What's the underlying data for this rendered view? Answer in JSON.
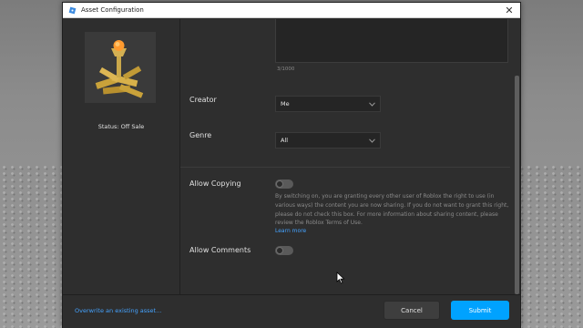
{
  "window": {
    "title": "Asset Configuration",
    "close_glyph": "✕"
  },
  "left": {
    "status": "Status: Off Sale",
    "thumbnail_icon": "torch-model-thumbnail"
  },
  "form": {
    "description_count": "3/1000",
    "creator": {
      "label": "Creator",
      "value": "Me"
    },
    "genre": {
      "label": "Genre",
      "value": "All"
    },
    "allow_copying": {
      "label": "Allow Copying",
      "enabled": false,
      "description": "By switching on, you are granting every other user of Roblox the right to use (in various ways) the content you are now sharing. If you do not want to grant this right, please do not check this box. For more information about sharing content, please review the Roblox Terms of Use.",
      "learn_more": "Learn more"
    },
    "allow_comments": {
      "label": "Allow Comments",
      "enabled": false
    }
  },
  "footer": {
    "overwrite_link": "Overwrite an existing asset...",
    "cancel_label": "Cancel",
    "submit_label": "Submit"
  },
  "colors": {
    "accent": "#00a2ff",
    "link": "#45a3ff",
    "panel": "#2e2e2e"
  }
}
